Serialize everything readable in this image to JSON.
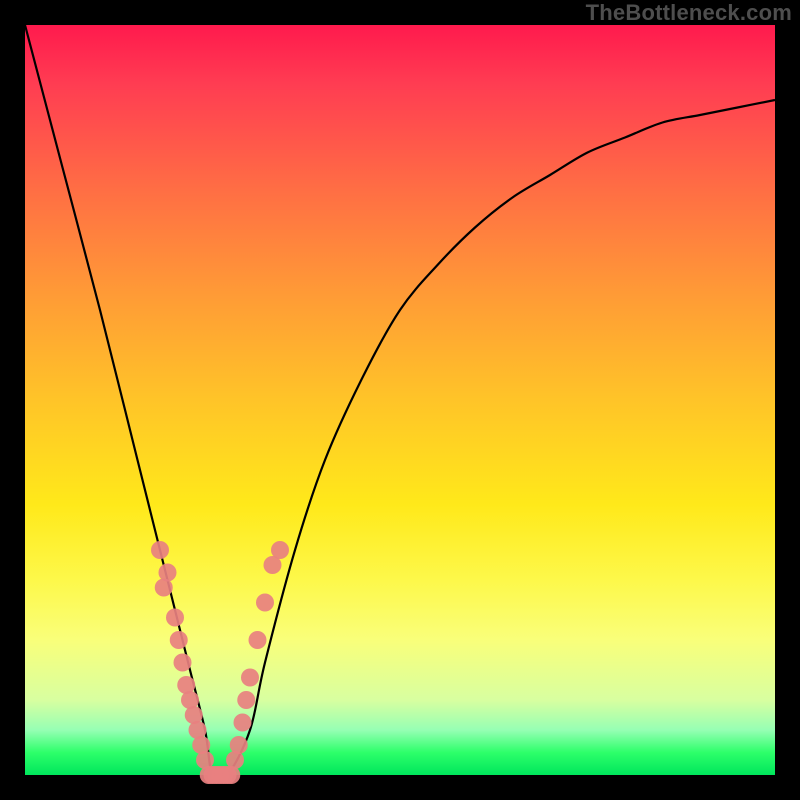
{
  "watermark": "TheBottleneck.com",
  "colors": {
    "frame_bg": "#000000",
    "gradient_top": "#ff1a4d",
    "gradient_bottom": "#00e65c",
    "curve": "#000000",
    "marker": "#e88080"
  },
  "chart_data": {
    "type": "line",
    "title": "",
    "xlabel": "",
    "ylabel": "",
    "x": [
      0,
      5,
      10,
      15,
      20,
      22,
      24,
      25,
      27,
      30,
      32,
      36,
      40,
      45,
      50,
      55,
      60,
      65,
      70,
      75,
      80,
      85,
      90,
      95,
      100
    ],
    "y": [
      100,
      81,
      62,
      42,
      22,
      14,
      6,
      0,
      0,
      6,
      15,
      30,
      42,
      53,
      62,
      68,
      73,
      77,
      80,
      83,
      85,
      87,
      88,
      89,
      90
    ],
    "xlim": [
      0,
      100
    ],
    "ylim": [
      0,
      100
    ],
    "marker_clusters": [
      {
        "side": "left",
        "points": [
          {
            "x": 18,
            "y": 30
          },
          {
            "x": 19,
            "y": 27
          },
          {
            "x": 18.5,
            "y": 25
          },
          {
            "x": 20,
            "y": 21
          },
          {
            "x": 20.5,
            "y": 18
          },
          {
            "x": 21,
            "y": 15
          },
          {
            "x": 21.5,
            "y": 12
          },
          {
            "x": 22,
            "y": 10
          },
          {
            "x": 22.5,
            "y": 8
          },
          {
            "x": 23,
            "y": 6
          },
          {
            "x": 23.5,
            "y": 4
          },
          {
            "x": 24,
            "y": 2
          }
        ]
      },
      {
        "side": "bottom",
        "points": [
          {
            "x": 24.5,
            "y": 0
          },
          {
            "x": 25,
            "y": 0
          },
          {
            "x": 25.5,
            "y": 0
          },
          {
            "x": 26,
            "y": 0
          },
          {
            "x": 26.5,
            "y": 0
          },
          {
            "x": 27,
            "y": 0
          },
          {
            "x": 27.5,
            "y": 0
          }
        ]
      },
      {
        "side": "right",
        "points": [
          {
            "x": 28,
            "y": 2
          },
          {
            "x": 28.5,
            "y": 4
          },
          {
            "x": 29,
            "y": 7
          },
          {
            "x": 29.5,
            "y": 10
          },
          {
            "x": 30,
            "y": 13
          },
          {
            "x": 31,
            "y": 18
          },
          {
            "x": 32,
            "y": 23
          },
          {
            "x": 33,
            "y": 28
          },
          {
            "x": 34,
            "y": 30
          }
        ]
      }
    ],
    "marker_radius": 9
  }
}
